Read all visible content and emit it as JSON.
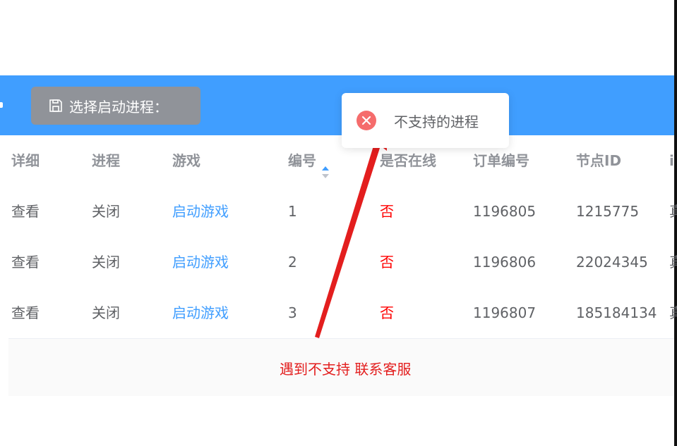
{
  "toolbar": {
    "select_process_label": "选择启动进程：",
    "save_icon": "save-icon"
  },
  "table": {
    "headers": [
      "详细",
      "进程",
      "游戏",
      "编号",
      "是否在线",
      "订单编号",
      "节点ID",
      "i"
    ],
    "rows": [
      {
        "detail": "查看",
        "process": "关闭",
        "game": "启动游戏",
        "number": "1",
        "online": "否",
        "order": "1196805",
        "node": "1215775",
        "extra": "真"
      },
      {
        "detail": "查看",
        "process": "关闭",
        "game": "启动游戏",
        "number": "2",
        "online": "否",
        "order": "1196806",
        "node": "22024345",
        "extra": "真"
      },
      {
        "detail": "查看",
        "process": "关闭",
        "game": "启动游戏",
        "number": "3",
        "online": "否",
        "order": "1196807",
        "node": "185184134",
        "extra": "真"
      }
    ],
    "sort_icon": "sort-caret-icon"
  },
  "toast": {
    "message": "不支持的进程",
    "icon": "error-circle-icon"
  },
  "annotation": {
    "note": "遇到不支持 联系客服"
  },
  "colors": {
    "primary": "#409eff",
    "button_gray": "#909399",
    "danger": "#f56c6c",
    "annotation_red": "#e31e1e"
  }
}
